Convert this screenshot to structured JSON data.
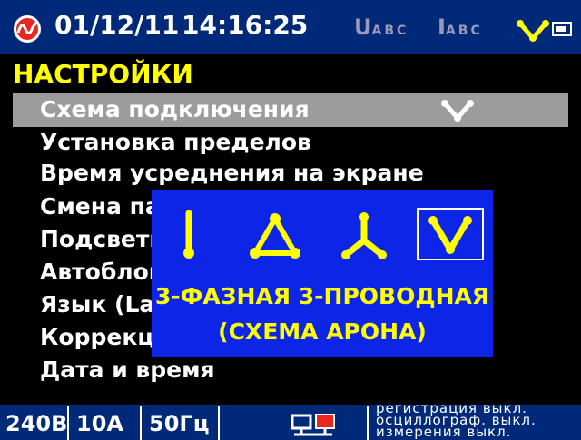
{
  "status_bar": {
    "date": "01/12/11",
    "time": "14:16:25",
    "voltage_indicator": {
      "letter": "U",
      "sub": "ABC"
    },
    "current_indicator": {
      "letter": "I",
      "sub": "ABC"
    },
    "connection_icon": "connection-scheme-icon",
    "battery_icon": "battery-icon",
    "logo_icon": "brand-logo-icon"
  },
  "menu": {
    "title": "НАСТРОЙКИ",
    "items": [
      {
        "label": "Схема подключения",
        "selected": true
      },
      {
        "label": "Установка пределов"
      },
      {
        "label": "Время усреднения на экране"
      },
      {
        "label": "Смена па"
      },
      {
        "label": "Подсветк"
      },
      {
        "label": "Автоблок"
      },
      {
        "label": "Язык (La"
      },
      {
        "label": "Коррекци"
      },
      {
        "label": "Дата и время"
      }
    ]
  },
  "popup": {
    "options": [
      "single-phase-icon",
      "delta-icon",
      "wye-icon",
      "aron-v-icon"
    ],
    "selected_option": "aron-v-icon",
    "line1": "3-ФАЗНАЯ 3-ПРОВОДНАЯ",
    "line2": "(СХЕМА АРОНА)"
  },
  "bottom_bar": {
    "voltage_range": "240В",
    "current_range": "10А",
    "frequency": "50Гц",
    "network_icon": "network-icon",
    "log_lines": [
      "регистрация выкл.",
      "осциллограф. выкл.",
      "измерения выкл."
    ]
  },
  "colors": {
    "status_bar": "#00297a",
    "title": "#ffff00",
    "highlight": "#9c9c9c",
    "popup": "#0d25e6",
    "popup_text": "#ffff00"
  }
}
